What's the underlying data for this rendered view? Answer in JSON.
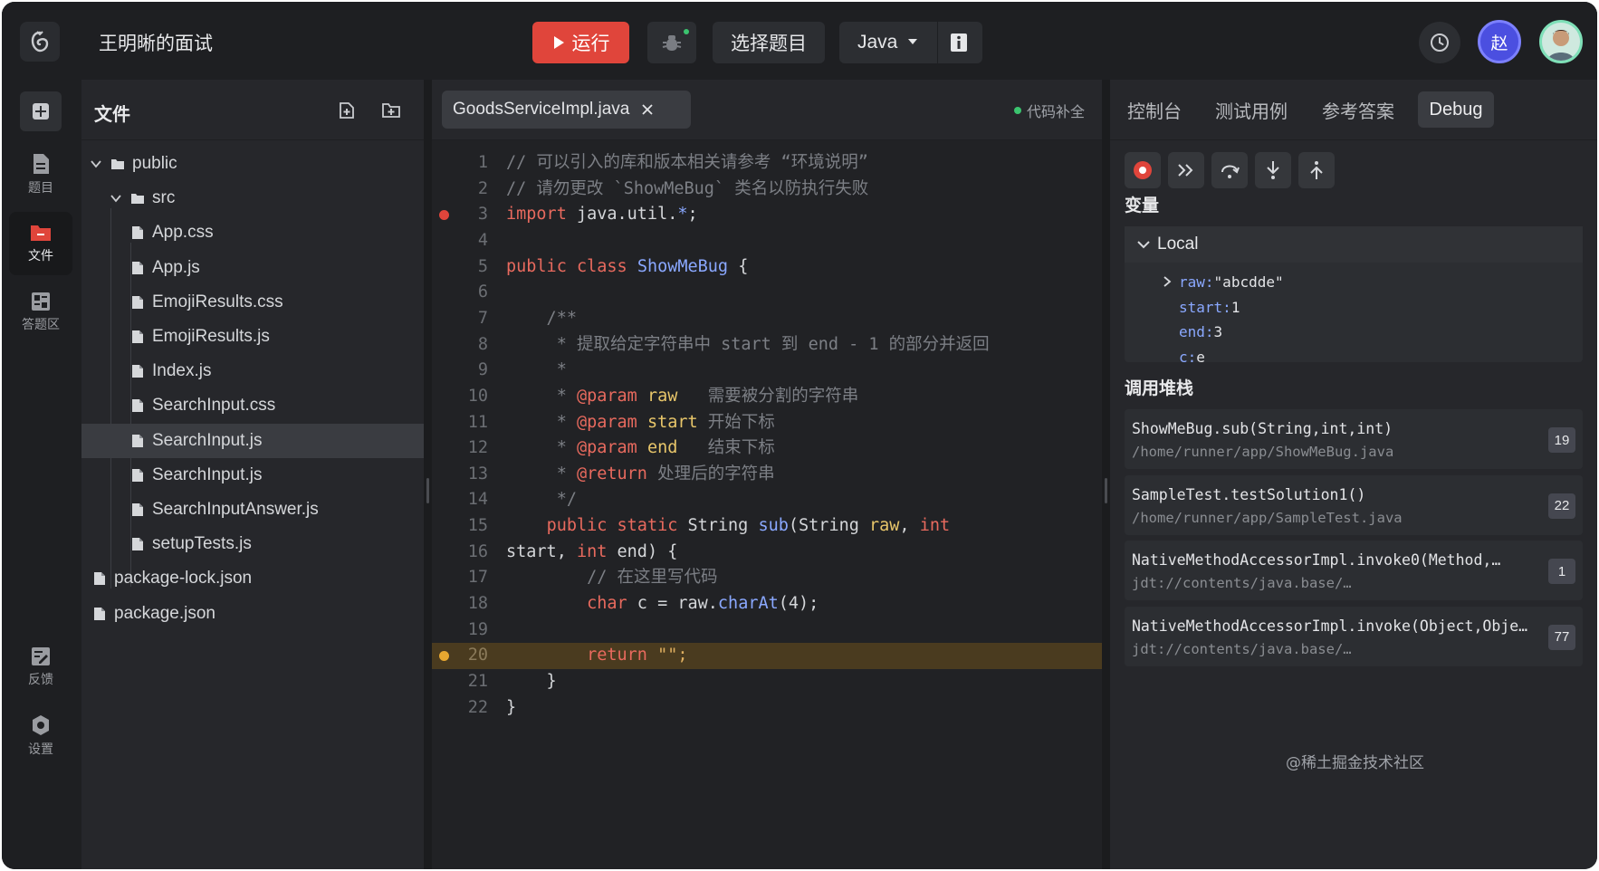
{
  "header": {
    "title": "王明晰的面试",
    "run_label": "运行",
    "select_problem_label": "选择题目",
    "language": "Java",
    "avatar_initial": "赵"
  },
  "rail": {
    "items": [
      {
        "label": "题目",
        "icon": "document-icon"
      },
      {
        "label": "文件",
        "icon": "folder-icon"
      },
      {
        "label": "答题区",
        "icon": "dashboard-icon"
      },
      {
        "label": "反馈",
        "icon": "edit-icon"
      },
      {
        "label": "设置",
        "icon": "gear-icon"
      }
    ]
  },
  "files": {
    "title": "文件",
    "tree": [
      {
        "name": "public",
        "type": "folder",
        "depth": 0,
        "expanded": true
      },
      {
        "name": "src",
        "type": "folder",
        "depth": 1,
        "expanded": true
      },
      {
        "name": "App.css",
        "type": "file",
        "depth": 2
      },
      {
        "name": "App.js",
        "type": "file",
        "depth": 2
      },
      {
        "name": "EmojiResults.css",
        "type": "file",
        "depth": 2
      },
      {
        "name": "EmojiResults.js",
        "type": "file",
        "depth": 2
      },
      {
        "name": "Index.js",
        "type": "file",
        "depth": 2
      },
      {
        "name": "SearchInput.css",
        "type": "file",
        "depth": 2
      },
      {
        "name": "SearchInput.js",
        "type": "file",
        "depth": 2,
        "selected": true
      },
      {
        "name": "SearchInput.js",
        "type": "file",
        "depth": 2
      },
      {
        "name": "SearchInputAnswer.js",
        "type": "file",
        "depth": 2
      },
      {
        "name": "setupTests.js",
        "type": "file",
        "depth": 2
      },
      {
        "name": "package-lock.json",
        "type": "file",
        "depth": 0
      },
      {
        "name": "package.json",
        "type": "file",
        "depth": 0
      }
    ]
  },
  "editor": {
    "tab_name": "GoodsServiceImpl.java",
    "autocomplete_label": "代码补全",
    "lines": [
      {
        "n": "1",
        "text": "// 可以引入的库和版本相关请参考 “环境说明”"
      },
      {
        "n": "2",
        "text": "// 请勿更改 `ShowMeBug` 类名以防执行失败"
      },
      {
        "n": "3",
        "text": "import java.util.*;",
        "breakpoint": "red"
      },
      {
        "n": "4",
        "text": ""
      },
      {
        "n": "5",
        "text": "public class ShowMeBug {"
      },
      {
        "n": "6",
        "text": ""
      },
      {
        "n": "7",
        "text": "    /**"
      },
      {
        "n": "8",
        "text": "     * 提取给定字符串中 start 到 end - 1 的部分并返回"
      },
      {
        "n": "9",
        "text": "     *"
      },
      {
        "n": "10",
        "text": "     * @param raw   需要被分割的字符串"
      },
      {
        "n": "11",
        "text": "     * @param start 开始下标"
      },
      {
        "n": "12",
        "text": "     * @param end   结束下标"
      },
      {
        "n": "13",
        "text": "     * @return 处理后的字符串"
      },
      {
        "n": "14",
        "text": "     */"
      },
      {
        "n": "15",
        "text": "    public static String sub(String raw, int"
      },
      {
        "n": "16",
        "text": "start, int end) {"
      },
      {
        "n": "17",
        "text": "        // 在这里写代码"
      },
      {
        "n": "18",
        "text": "        char c = raw.charAt(4);"
      },
      {
        "n": "19",
        "text": ""
      },
      {
        "n": "20",
        "text": "        return \"\";",
        "breakpoint": "yellow",
        "highlight": true
      },
      {
        "n": "21",
        "text": "    }"
      },
      {
        "n": "22",
        "text": "}"
      }
    ]
  },
  "right_panel": {
    "tabs": [
      "控制台",
      "测试用例",
      "参考答案",
      "Debug"
    ],
    "active_tab": "Debug",
    "variables_title": "变量",
    "scope_label": "Local",
    "variables": [
      {
        "name": "raw",
        "value": "\"abcdde\"",
        "expandable": true
      },
      {
        "name": "start",
        "value": "1"
      },
      {
        "name": "end",
        "value": "3"
      },
      {
        "name": "c",
        "value": "e"
      }
    ],
    "callstack_title": "调用堆栈",
    "callstack": [
      {
        "fn": "ShowMeBug.sub(String,int,int)",
        "path": "/home/runner/app/ShowMeBug.java",
        "line": "19"
      },
      {
        "fn": "SampleTest.testSolution1()",
        "path": "/home/runner/app/SampleTest.java",
        "line": "22"
      },
      {
        "fn": "NativeMethodAccessorImpl.invoke0(Method,…",
        "path": "jdt://contents/java.base/…",
        "line": "1"
      },
      {
        "fn": "NativeMethodAccessorImpl.invoke(Object,Obje…",
        "path": "jdt://contents/java.base/…",
        "line": "77"
      }
    ]
  },
  "watermark": "@稀土掘金技术社区",
  "colors": {
    "background": "#1e1f22",
    "panel": "#26272b",
    "run_button": "#e0453b",
    "keyword": "#e86a5e",
    "class_name": "#8aa8ff",
    "highlight_line": "#4a3b1f",
    "breakpoint_red": "#e0453b",
    "breakpoint_yellow": "#e8a830",
    "autocomplete_dot": "#3bc46f"
  }
}
